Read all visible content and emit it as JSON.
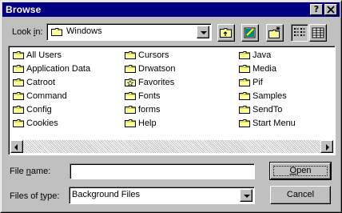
{
  "window": {
    "title": "Browse"
  },
  "lookin": {
    "label_pre": "Look ",
    "label_key": "i",
    "label_post": "n:",
    "value": "Windows"
  },
  "toolbar": {
    "buttons": [
      "up-one-level",
      "desktop",
      "new-folder",
      "list-view",
      "details-view"
    ]
  },
  "files": {
    "columns": [
      [
        {
          "name": "All Users",
          "icon": "folder"
        },
        {
          "name": "Application Data",
          "icon": "folder"
        },
        {
          "name": "Catroot",
          "icon": "folder"
        },
        {
          "name": "Command",
          "icon": "folder"
        },
        {
          "name": "Config",
          "icon": "folder"
        },
        {
          "name": "Cookies",
          "icon": "folder"
        }
      ],
      [
        {
          "name": "Cursors",
          "icon": "folder"
        },
        {
          "name": "Drwatson",
          "icon": "folder"
        },
        {
          "name": "Favorites",
          "icon": "favorites"
        },
        {
          "name": "Fonts",
          "icon": "folder"
        },
        {
          "name": "forms",
          "icon": "folder"
        },
        {
          "name": "Help",
          "icon": "folder"
        }
      ],
      [
        {
          "name": "Java",
          "icon": "folder"
        },
        {
          "name": "Media",
          "icon": "folder"
        },
        {
          "name": "Pif",
          "icon": "folder"
        },
        {
          "name": "Samples",
          "icon": "folder"
        },
        {
          "name": "SendTo",
          "icon": "folder"
        },
        {
          "name": "Start Menu",
          "icon": "folder"
        }
      ]
    ]
  },
  "filename": {
    "label_pre": "File ",
    "label_key": "n",
    "label_post": "ame:",
    "value": ""
  },
  "filetype": {
    "label_pre": "Files of ",
    "label_key": "t",
    "label_post": "ype:",
    "value": "Background Files"
  },
  "buttons": {
    "open_key": "O",
    "open_rest": "pen",
    "cancel": "Cancel"
  },
  "colors": {
    "titlebar": "#000080",
    "face": "#c0c0c0",
    "folder": "#ffff99"
  }
}
